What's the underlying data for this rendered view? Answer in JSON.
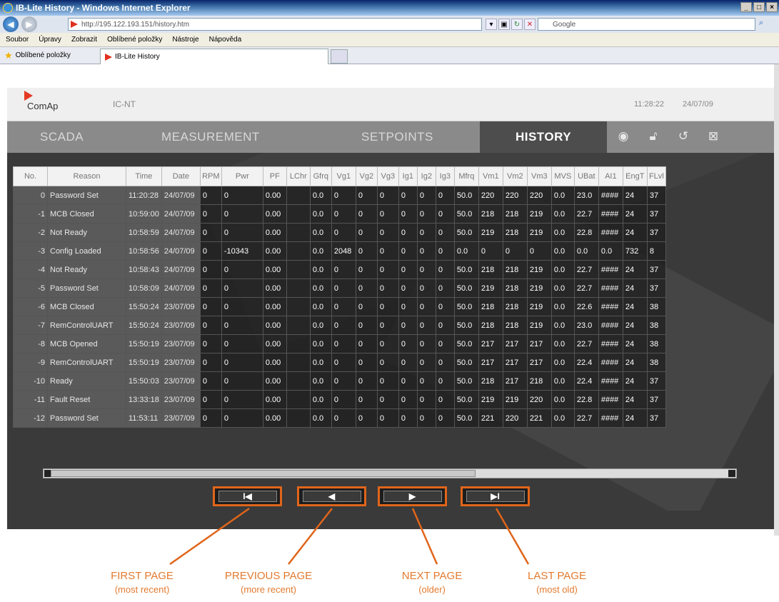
{
  "browser": {
    "window_title": "IB-Lite History - Windows Internet Explorer",
    "url": "http://195.122.193.151/history.htm",
    "search_placeholder": "Google",
    "menu": [
      "Soubor",
      "Úpravy",
      "Zobrazit",
      "Oblíbené položky",
      "Nástroje",
      "Nápověda"
    ],
    "favorites_label": "Oblíbené položky",
    "tab_title": "IB-Lite History"
  },
  "app": {
    "logo_text": "ComAp",
    "device": "IC-NT",
    "time": "11:28:22",
    "date": "24/07/09",
    "tabs": [
      "SCADA",
      "MEASUREMENT",
      "SETPOINTS",
      "HISTORY"
    ],
    "active_tab": "HISTORY"
  },
  "table": {
    "columns": [
      "No.",
      "Reason",
      "Time",
      "Date",
      "RPM",
      "Pwr",
      "PF",
      "LChr",
      "Gfrq",
      "Vg1",
      "Vg2",
      "Vg3",
      "Ig1",
      "Ig2",
      "Ig3",
      "Mfrq",
      "Vm1",
      "Vm2",
      "Vm3",
      "MVS",
      "UBat",
      "AI1",
      "EngT",
      "FLvl"
    ],
    "rows": [
      [
        "0",
        "Password Set",
        "11:20:28",
        "24/07/09",
        "0",
        "0",
        "0.00",
        "",
        "0.0",
        "0",
        "0",
        "0",
        "0",
        "0",
        "0",
        "50.0",
        "220",
        "220",
        "220",
        "0.0",
        "23.0",
        "####",
        "24",
        "37"
      ],
      [
        "-1",
        "MCB Closed",
        "10:59:00",
        "24/07/09",
        "0",
        "0",
        "0.00",
        "",
        "0.0",
        "0",
        "0",
        "0",
        "0",
        "0",
        "0",
        "50.0",
        "218",
        "218",
        "219",
        "0.0",
        "22.7",
        "####",
        "24",
        "37"
      ],
      [
        "-2",
        "Not Ready",
        "10:58:59",
        "24/07/09",
        "0",
        "0",
        "0.00",
        "",
        "0.0",
        "0",
        "0",
        "0",
        "0",
        "0",
        "0",
        "50.0",
        "219",
        "218",
        "219",
        "0.0",
        "22.8",
        "####",
        "24",
        "37"
      ],
      [
        "-3",
        "Config Loaded",
        "10:58:56",
        "24/07/09",
        "0",
        "-10343",
        "0.00",
        "",
        "0.0",
        "2048",
        "0",
        "0",
        "0",
        "0",
        "0",
        "0.0",
        "0",
        "0",
        "0",
        "0.0",
        "0.0",
        "0.0",
        "732",
        "8"
      ],
      [
        "-4",
        "Not Ready",
        "10:58:43",
        "24/07/09",
        "0",
        "0",
        "0.00",
        "",
        "0.0",
        "0",
        "0",
        "0",
        "0",
        "0",
        "0",
        "50.0",
        "218",
        "218",
        "219",
        "0.0",
        "22.7",
        "####",
        "24",
        "37"
      ],
      [
        "-5",
        "Password Set",
        "10:58:09",
        "24/07/09",
        "0",
        "0",
        "0.00",
        "",
        "0.0",
        "0",
        "0",
        "0",
        "0",
        "0",
        "0",
        "50.0",
        "219",
        "218",
        "219",
        "0.0",
        "22.7",
        "####",
        "24",
        "37"
      ],
      [
        "-6",
        "MCB Closed",
        "15:50:24",
        "23/07/09",
        "0",
        "0",
        "0.00",
        "",
        "0.0",
        "0",
        "0",
        "0",
        "0",
        "0",
        "0",
        "50.0",
        "218",
        "218",
        "219",
        "0.0",
        "22.6",
        "####",
        "24",
        "38"
      ],
      [
        "-7",
        "RemControlUART",
        "15:50:24",
        "23/07/09",
        "0",
        "0",
        "0.00",
        "",
        "0.0",
        "0",
        "0",
        "0",
        "0",
        "0",
        "0",
        "50.0",
        "218",
        "218",
        "219",
        "0.0",
        "23.0",
        "####",
        "24",
        "38"
      ],
      [
        "-8",
        "MCB Opened",
        "15:50:19",
        "23/07/09",
        "0",
        "0",
        "0.00",
        "",
        "0.0",
        "0",
        "0",
        "0",
        "0",
        "0",
        "0",
        "50.0",
        "217",
        "217",
        "217",
        "0.0",
        "22.7",
        "####",
        "24",
        "38"
      ],
      [
        "-9",
        "RemControlUART",
        "15:50:19",
        "23/07/09",
        "0",
        "0",
        "0.00",
        "",
        "0.0",
        "0",
        "0",
        "0",
        "0",
        "0",
        "0",
        "50.0",
        "217",
        "217",
        "217",
        "0.0",
        "22.4",
        "####",
        "24",
        "38"
      ],
      [
        "-10",
        "Ready",
        "15:50:03",
        "23/07/09",
        "0",
        "0",
        "0.00",
        "",
        "0.0",
        "0",
        "0",
        "0",
        "0",
        "0",
        "0",
        "50.0",
        "218",
        "217",
        "218",
        "0.0",
        "22.4",
        "####",
        "24",
        "37"
      ],
      [
        "-11",
        "Fault Reset",
        "13:33:18",
        "23/07/09",
        "0",
        "0",
        "0.00",
        "",
        "0.0",
        "0",
        "0",
        "0",
        "0",
        "0",
        "0",
        "50.0",
        "219",
        "219",
        "220",
        "0.0",
        "22.8",
        "####",
        "24",
        "37"
      ],
      [
        "-12",
        "Password Set",
        "11:53:11",
        "23/07/09",
        "0",
        "0",
        "0.00",
        "",
        "0.0",
        "0",
        "0",
        "0",
        "0",
        "0",
        "0",
        "50.0",
        "221",
        "220",
        "221",
        "0.0",
        "22.7",
        "####",
        "24",
        "37"
      ]
    ]
  },
  "pager": {
    "first": "I◀",
    "prev": "◀",
    "next": "▶",
    "last": "▶I"
  },
  "annotations": {
    "first": {
      "title": "FIRST PAGE",
      "sub": "(most recent)"
    },
    "prev": {
      "title": "PREVIOUS PAGE",
      "sub": "(more recent)"
    },
    "next": {
      "title": "NEXT PAGE",
      "sub": "(older)"
    },
    "last": {
      "title": "LAST PAGE",
      "sub": "(most old)"
    }
  },
  "colors": {
    "accent": "#e0651a",
    "annotation_text": "#e37a2e",
    "tab_active": "#4d4d4d",
    "logo_red": "#e53a22"
  }
}
